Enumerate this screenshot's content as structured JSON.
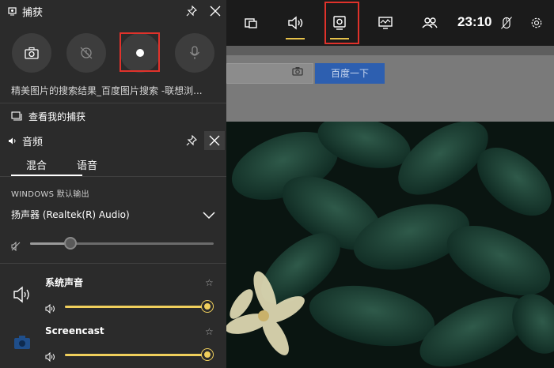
{
  "capture": {
    "title": "捕获",
    "description": "精美图片的搜索结果_百度图片搜索 -联想浏...",
    "view_captures": "查看我的捕获"
  },
  "audio": {
    "title": "音频",
    "tabs": [
      "混合",
      "语音"
    ],
    "output_label": "WINDOWS 默认输出",
    "device": "扬声器 (Realtek(R) Audio)",
    "master_volume": 0.22,
    "apps": [
      {
        "name": "系统声音",
        "volume": 1.0
      },
      {
        "name": "Screencast",
        "volume": 1.0
      }
    ]
  },
  "gamebar": {
    "time": "23:10",
    "icons": [
      "widget-menu-icon",
      "audio-icon",
      "capture-icon",
      "performance-icon",
      "xbox-social-icon",
      "mouse-icon",
      "settings-icon"
    ]
  },
  "browser": {
    "search_button": "百度一下"
  },
  "colors": {
    "accent": "#f0cf5c",
    "highlight": "#e0322b",
    "panel": "#2b2b2b"
  }
}
